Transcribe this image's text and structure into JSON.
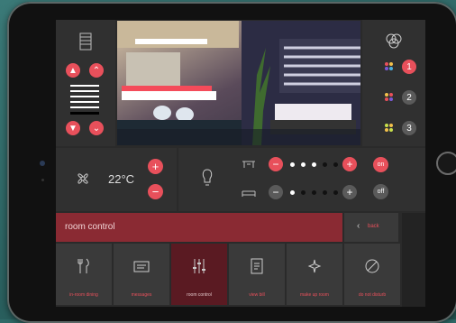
{
  "climate": {
    "temperature": "22°C"
  },
  "scene_buttons": [
    {
      "label": "1"
    },
    {
      "label": "2"
    },
    {
      "label": "3"
    }
  ],
  "switch_buttons": {
    "on": "on",
    "off": "off"
  },
  "title_bar": {
    "title": "room control",
    "back": "back"
  },
  "nav": [
    {
      "label": "in-room dining",
      "icon": "fork-knife-icon"
    },
    {
      "label": "messages",
      "icon": "message-icon"
    },
    {
      "label": "room control",
      "icon": "sliders-icon",
      "active": true
    },
    {
      "label": "view bill",
      "icon": "bill-icon"
    },
    {
      "label": "make up room",
      "icon": "sparkle-icon"
    },
    {
      "label": "do not disturb",
      "icon": "no-disturb-icon"
    }
  ],
  "light_levels": {
    "ceiling": 0.6,
    "bed": 0.2
  },
  "colors": {
    "accent": "#e8505b",
    "title_bar": "#8a2a33",
    "active_nav": "#5a1a22"
  }
}
